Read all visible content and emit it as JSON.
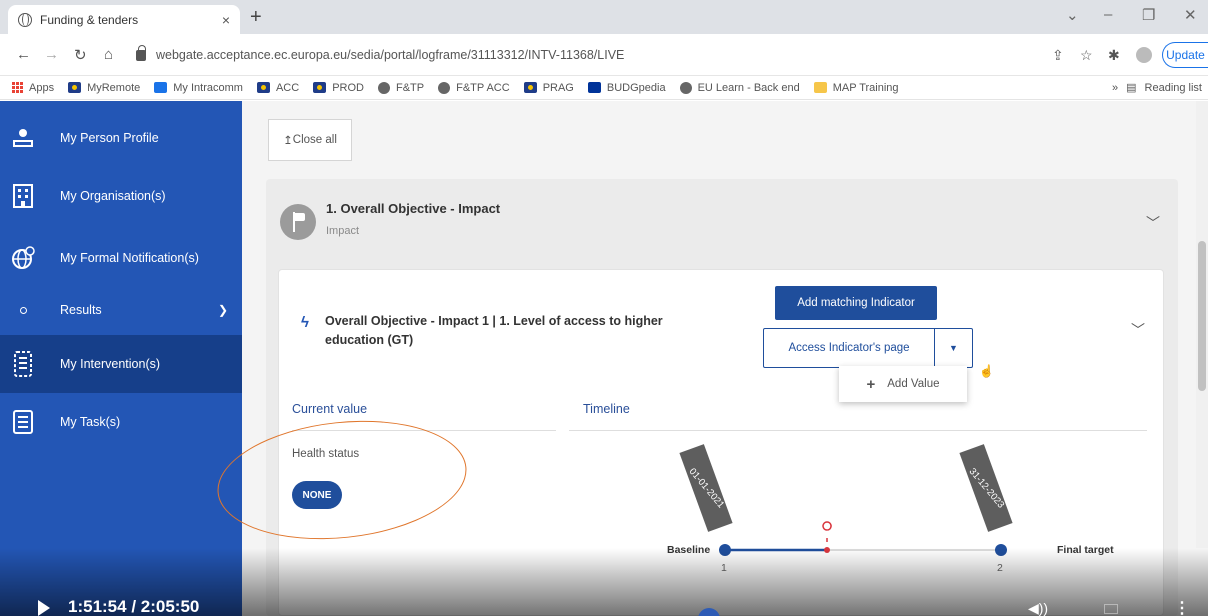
{
  "browser": {
    "tab_title": "Funding & tenders",
    "tab_close": "×",
    "new_tab": "+",
    "url": "webgate.acceptance.ec.europa.eu/sedia/portal/logframe/31113312/INTV-11368/LIVE",
    "update_label": "Update",
    "bookmarks": [
      "Apps",
      "MyRemote",
      "My Intracomm",
      "ACC",
      "PROD",
      "F&TP",
      "F&TP ACC",
      "PRAG",
      "BUDGpedia",
      "EU Learn - Back end",
      "MAP Training"
    ],
    "overflow": "»",
    "reading_list": "Reading list"
  },
  "sidebar": {
    "items": [
      {
        "label": "My Person Profile",
        "icon": "beta-profile-icon"
      },
      {
        "label": "My Organisation(s)",
        "icon": "building-icon"
      },
      {
        "label": "My Formal Notification(s)",
        "icon": "globe-notification-icon"
      },
      {
        "label": "Results",
        "icon": "circle-icon"
      },
      {
        "label": "My Intervention(s)",
        "icon": "intervention-icon"
      },
      {
        "label": "My Task(s)",
        "icon": "task-icon"
      }
    ]
  },
  "main": {
    "close_all": "Close all",
    "objective": {
      "title": "1. Overall Objective - Impact",
      "subtitle": "Impact"
    },
    "indicator": {
      "title": "Overall Objective - Impact 1 | 1. Level of access to higher education (GT)",
      "add_matching": "Add matching Indicator",
      "access_page": "Access Indicator's page",
      "add_value": "Add Value"
    },
    "current_value_header": "Current value",
    "timeline_header": "Timeline",
    "health_status_label": "Health status",
    "health_status_value": "NONE",
    "timeline": {
      "start_date": "01-01-2021",
      "end_date": "31-12-2023",
      "baseline_label": "Baseline",
      "final_label": "Final target",
      "baseline_value": "1",
      "final_value": "2"
    }
  },
  "video": {
    "timecode": "1:51:54 / 2:05:50"
  },
  "colors": {
    "sidebar": "#2356b5",
    "sidebar_active": "#163f8a",
    "primary": "#1f4e9c",
    "annotation": "#e0762c",
    "marker": "#d9363e"
  }
}
